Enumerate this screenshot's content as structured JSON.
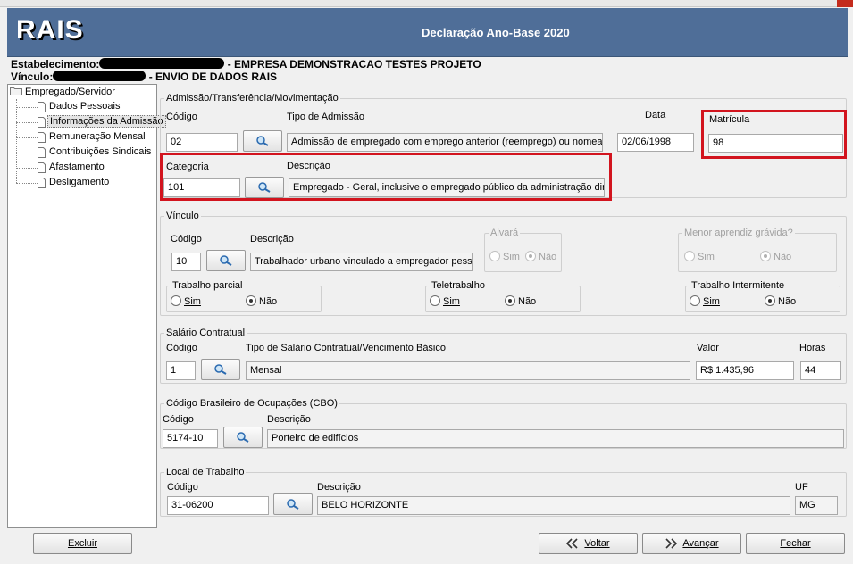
{
  "banner": {
    "logo": "RAIS",
    "title": "Declaração Ano-Base 2020"
  },
  "header": {
    "estab_label": "Estabelecimento:",
    "estab_name": "- EMPRESA DEMONSTRACAO TESTES PROJETO",
    "vinc_label": "Vínculo:",
    "vinc_name": "- ENVIO DE DADOS RAIS"
  },
  "tree": {
    "root": "Empregado/Servidor",
    "items": [
      "Dados Pessoais",
      "Informações da Admissão",
      "Remuneração Mensal",
      "Contribuições Sindicais",
      "Afastamento",
      "Desligamento"
    ],
    "selected_index": 1
  },
  "admissao": {
    "legend": "Admissão/Transferência/Movimentação",
    "codigo_label": "Código",
    "codigo_value": "02",
    "tipo_label": "Tipo de Admissão",
    "tipo_value": "Admissão de empregado com emprego anterior (reemprego) ou nomeaç",
    "data_label": "Data",
    "data_value": "02/06/1998",
    "matricula_label": "Matrícula",
    "matricula_value": "98",
    "categoria_label": "Categoria",
    "categoria_value": "101",
    "descricao_label": "Descrição",
    "descricao_value": "Empregado - Geral, inclusive o empregado público da administração diret"
  },
  "vinculo": {
    "legend": "Vínculo",
    "codigo_label": "Código",
    "codigo_value": "10",
    "descricao_label": "Descrição",
    "descricao_value": "Trabalhador urbano vinculado a empregador pesso",
    "alvara_legend": "Alvará",
    "menor_legend": "Menor aprendiz grávida?",
    "parcial_legend": "Trabalho parcial",
    "tele_legend": "Teletrabalho",
    "intermitente_legend": "Trabalho Intermitente",
    "sim": "Sim",
    "nao": "Não"
  },
  "salario": {
    "legend": "Salário Contratual",
    "codigo_label": "Código",
    "codigo_value": "1",
    "tipo_label": "Tipo de Salário Contratual/Vencimento Básico",
    "tipo_value": "Mensal",
    "valor_label": "Valor",
    "valor_value": "R$ 1.435,96",
    "horas_label": "Horas",
    "horas_value": "44"
  },
  "cbo": {
    "legend": "Código Brasileiro de Ocupações (CBO)",
    "codigo_label": "Código",
    "codigo_value": "5174-10",
    "descricao_label": "Descrição",
    "descricao_value": "Porteiro de edifícios"
  },
  "local": {
    "legend": "Local de Trabalho",
    "codigo_label": "Código",
    "codigo_value": "31-06200",
    "descricao_label": "Descrição",
    "descricao_value": "BELO HORIZONTE",
    "uf_label": "UF",
    "uf_value": "MG"
  },
  "footer": {
    "excluir": "Excluir",
    "voltar": "Voltar",
    "avancar": "Avançar",
    "fechar": "Fechar"
  },
  "colors": {
    "banner": "#4f6e98",
    "highlight": "#d2141e"
  },
  "icons": [
    "magnifier-icon",
    "folder-icon",
    "file-icon",
    "back-arrow-icon",
    "forward-arrow-icon"
  ]
}
